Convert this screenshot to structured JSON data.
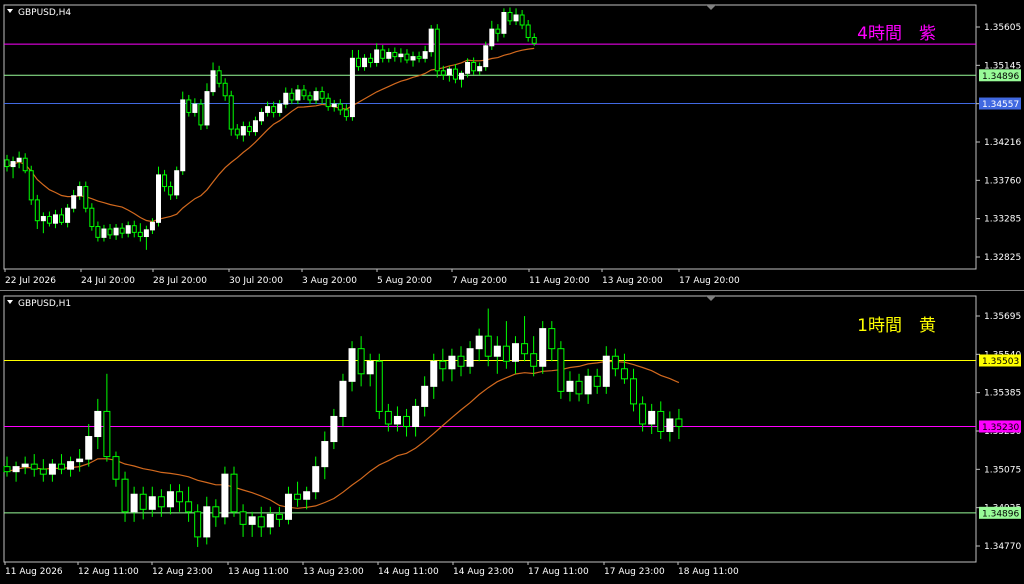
{
  "colors": {
    "background": "#000000",
    "frame": "#c0c0c0",
    "axis_text": "#ffffff",
    "bull": "#ffffff",
    "bear": "#00ff00",
    "ma": "#d2691e",
    "purple": "#ff00ff",
    "yellow": "#ffff00",
    "mint": "#98fb98",
    "blue": "#4169e1"
  },
  "chart_data": [
    {
      "type": "candlestick",
      "symbol_label": "GBPUSD,H4",
      "title": "4時間　紫",
      "title_color": "#ff00ff",
      "ylim": [
        1.3257,
        1.3574
      ],
      "yticks": [
        "1.35605",
        "1.35145",
        "1.34606",
        "1.34216",
        "1.33760",
        "1.33285",
        "1.32825"
      ],
      "xticks": [
        "22 Jul 2026",
        "24 Jul 20:00",
        "28 Jul 20:00",
        "30 Jul 20:00",
        "3 Aug 20:00",
        "5 Aug 20:00",
        "7 Aug 20:00",
        "11 Aug 20:00",
        "13 Aug 20:00",
        "17 Aug 20:00"
      ],
      "levels": [
        {
          "price": 1.3527,
          "color": "#ff00ff",
          "label": ""
        },
        {
          "price": 1.34896,
          "color": "#98fb98",
          "label": "1.34896"
        },
        {
          "price": 1.34557,
          "color": "#4169e1",
          "label": "1.34557"
        }
      ],
      "ohlc": [
        [
          1.3388,
          1.3394,
          1.3374,
          1.338
        ],
        [
          1.338,
          1.3392,
          1.3366,
          1.3386
        ],
        [
          1.3386,
          1.3398,
          1.3378,
          1.339
        ],
        [
          1.339,
          1.3396,
          1.3372,
          1.3375
        ],
        [
          1.3375,
          1.3381,
          1.3334,
          1.334
        ],
        [
          1.334,
          1.3346,
          1.3305,
          1.3315
        ],
        [
          1.3315,
          1.3325,
          1.33,
          1.332
        ],
        [
          1.332,
          1.3326,
          1.3308,
          1.3312
        ],
        [
          1.3312,
          1.3328,
          1.3306,
          1.3322
        ],
        [
          1.3322,
          1.333,
          1.331,
          1.3313
        ],
        [
          1.3313,
          1.3335,
          1.3307,
          1.333
        ],
        [
          1.333,
          1.3352,
          1.3325,
          1.3345
        ],
        [
          1.3345,
          1.3362,
          1.334,
          1.3356
        ],
        [
          1.3356,
          1.3362,
          1.3325,
          1.333
        ],
        [
          1.333,
          1.3336,
          1.3303,
          1.3308
        ],
        [
          1.3308,
          1.3314,
          1.329,
          1.3295
        ],
        [
          1.3295,
          1.331,
          1.329,
          1.3305
        ],
        [
          1.3305,
          1.3311,
          1.3293,
          1.3298
        ],
        [
          1.3298,
          1.3311,
          1.3292,
          1.3306
        ],
        [
          1.3306,
          1.3312,
          1.3294,
          1.33
        ],
        [
          1.33,
          1.3314,
          1.3295,
          1.3309
        ],
        [
          1.3309,
          1.3315,
          1.3295,
          1.3301
        ],
        [
          1.3301,
          1.3312,
          1.329,
          1.3296
        ],
        [
          1.3296,
          1.3309,
          1.328,
          1.3304
        ],
        [
          1.3304,
          1.3318,
          1.3299,
          1.3313
        ],
        [
          1.3313,
          1.338,
          1.3308,
          1.337
        ],
        [
          1.337,
          1.3376,
          1.335,
          1.3356
        ],
        [
          1.3356,
          1.3362,
          1.334,
          1.3346
        ],
        [
          1.3346,
          1.338,
          1.3341,
          1.3375
        ],
        [
          1.3375,
          1.347,
          1.337,
          1.346
        ],
        [
          1.346,
          1.3466,
          1.344,
          1.3445
        ],
        [
          1.3445,
          1.3462,
          1.344,
          1.3455
        ],
        [
          1.3455,
          1.3461,
          1.3424,
          1.343
        ],
        [
          1.343,
          1.348,
          1.3425,
          1.347
        ],
        [
          1.347,
          1.3505,
          1.3465,
          1.3495
        ],
        [
          1.3495,
          1.3501,
          1.3475,
          1.348
        ],
        [
          1.348,
          1.3486,
          1.3459,
          1.3465
        ],
        [
          1.3465,
          1.3471,
          1.3417,
          1.3425
        ],
        [
          1.3425,
          1.3431,
          1.3413,
          1.3418
        ],
        [
          1.3418,
          1.3434,
          1.341,
          1.3428
        ],
        [
          1.3428,
          1.3434,
          1.3417,
          1.3422
        ],
        [
          1.3422,
          1.344,
          1.3417,
          1.3435
        ],
        [
          1.3435,
          1.345,
          1.343,
          1.3445
        ],
        [
          1.3445,
          1.3458,
          1.344,
          1.3452
        ],
        [
          1.3452,
          1.3458,
          1.3439,
          1.3445
        ],
        [
          1.3445,
          1.346,
          1.344,
          1.3455
        ],
        [
          1.3455,
          1.3475,
          1.345,
          1.3468
        ],
        [
          1.3468,
          1.3474,
          1.3455,
          1.346
        ],
        [
          1.346,
          1.3478,
          1.3455,
          1.3472
        ],
        [
          1.3472,
          1.3478,
          1.346,
          1.3465
        ],
        [
          1.3465,
          1.347,
          1.3455,
          1.346
        ],
        [
          1.346,
          1.3475,
          1.3455,
          1.347
        ],
        [
          1.347,
          1.3476,
          1.3455,
          1.3462
        ],
        [
          1.3462,
          1.3468,
          1.3447,
          1.3452
        ],
        [
          1.3452,
          1.346,
          1.3446,
          1.3455
        ],
        [
          1.3455,
          1.3461,
          1.3442,
          1.3448
        ],
        [
          1.3448,
          1.3455,
          1.3435,
          1.344
        ],
        [
          1.344,
          1.352,
          1.3435,
          1.351
        ],
        [
          1.351,
          1.352,
          1.3495,
          1.35
        ],
        [
          1.35,
          1.3515,
          1.3495,
          1.351
        ],
        [
          1.351,
          1.3516,
          1.3499,
          1.3505
        ],
        [
          1.3505,
          1.3528,
          1.35,
          1.352
        ],
        [
          1.352,
          1.3526,
          1.3505,
          1.351
        ],
        [
          1.351,
          1.3522,
          1.3505,
          1.3517
        ],
        [
          1.3517,
          1.3523,
          1.3506,
          1.3512
        ],
        [
          1.3512,
          1.3522,
          1.3505,
          1.3515
        ],
        [
          1.3515,
          1.3521,
          1.3504,
          1.3508
        ],
        [
          1.3508,
          1.3518,
          1.35,
          1.3512
        ],
        [
          1.3512,
          1.3518,
          1.3505,
          1.351
        ],
        [
          1.351,
          1.3525,
          1.3505,
          1.3518
        ],
        [
          1.3518,
          1.355,
          1.3512,
          1.3545
        ],
        [
          1.3545,
          1.3551,
          1.3487,
          1.3495
        ],
        [
          1.3495,
          1.3501,
          1.3484,
          1.349
        ],
        [
          1.349,
          1.35,
          1.3482,
          1.3497
        ],
        [
          1.3497,
          1.3503,
          1.348,
          1.3485
        ],
        [
          1.3485,
          1.3495,
          1.3475,
          1.3492
        ],
        [
          1.3492,
          1.351,
          1.3487,
          1.3505
        ],
        [
          1.3505,
          1.3511,
          1.349,
          1.3495
        ],
        [
          1.3495,
          1.3505,
          1.349,
          1.35
        ],
        [
          1.35,
          1.353,
          1.3495,
          1.3525
        ],
        [
          1.3525,
          1.3555,
          1.352,
          1.3545
        ],
        [
          1.3545,
          1.3551,
          1.353,
          1.354
        ],
        [
          1.354,
          1.357,
          1.3535,
          1.3565
        ],
        [
          1.3565,
          1.3571,
          1.355,
          1.3555
        ],
        [
          1.3555,
          1.357,
          1.355,
          1.3562
        ],
        [
          1.3562,
          1.3568,
          1.3545,
          1.355
        ],
        [
          1.355,
          1.3556,
          1.353,
          1.3535
        ],
        [
          1.3535,
          1.354,
          1.3525,
          1.3528
        ]
      ]
    },
    {
      "type": "candlestick",
      "symbol_label": "GBPUSD,H1",
      "title": "1時間　黄",
      "title_color": "#ffff00",
      "ylim": [
        1.347,
        1.3576
      ],
      "yticks": [
        "1.35695",
        "1.35540",
        "1.35385",
        "1.35230",
        "1.35075",
        "1.34925",
        "1.34770"
      ],
      "xticks": [
        "11 Aug 2026",
        "12 Aug 11:00",
        "12 Aug 23:00",
        "13 Aug 11:00",
        "13 Aug 23:00",
        "14 Aug 11:00",
        "14 Aug 23:00",
        "17 Aug 11:00",
        "17 Aug 23:00",
        "18 Aug 11:00"
      ],
      "levels": [
        {
          "price": 1.35503,
          "color": "#ffff00",
          "label": "1.35503"
        },
        {
          "price": 1.3524,
          "color": "#ff00ff",
          "label": "1.35230"
        },
        {
          "price": 1.34896,
          "color": "#98fb98",
          "label": "1.34896"
        }
      ],
      "ohlc": [
        [
          1.3508,
          1.3512,
          1.3504,
          1.3506
        ],
        [
          1.3506,
          1.351,
          1.3502,
          1.3508
        ],
        [
          1.3508,
          1.3512,
          1.3505,
          1.3509
        ],
        [
          1.3509,
          1.3513,
          1.3504,
          1.3507
        ],
        [
          1.3507,
          1.3511,
          1.3502,
          1.3505
        ],
        [
          1.3505,
          1.3511,
          1.3502,
          1.3509
        ],
        [
          1.3509,
          1.3513,
          1.3505,
          1.3507
        ],
        [
          1.3507,
          1.3512,
          1.3504,
          1.351
        ],
        [
          1.351,
          1.3515,
          1.3506,
          1.3511
        ],
        [
          1.3511,
          1.3525,
          1.3508,
          1.352
        ],
        [
          1.352,
          1.3535,
          1.3515,
          1.353
        ],
        [
          1.353,
          1.3545,
          1.351,
          1.3512
        ],
        [
          1.3512,
          1.3514,
          1.35,
          1.3503
        ],
        [
          1.3503,
          1.3506,
          1.3486,
          1.349
        ],
        [
          1.349,
          1.35,
          1.3486,
          1.3497
        ],
        [
          1.3497,
          1.35,
          1.3487,
          1.3491
        ],
        [
          1.3491,
          1.35,
          1.3488,
          1.3496
        ],
        [
          1.3496,
          1.3499,
          1.3488,
          1.3492
        ],
        [
          1.3492,
          1.3501,
          1.3489,
          1.3498
        ],
        [
          1.3498,
          1.3501,
          1.349,
          1.3494
        ],
        [
          1.3494,
          1.35,
          1.3486,
          1.349
        ],
        [
          1.349,
          1.3493,
          1.3476,
          1.348
        ],
        [
          1.348,
          1.3496,
          1.3477,
          1.3492
        ],
        [
          1.3492,
          1.3495,
          1.3484,
          1.3488
        ],
        [
          1.3488,
          1.3508,
          1.3485,
          1.3505
        ],
        [
          1.3505,
          1.3508,
          1.3488,
          1.349
        ],
        [
          1.349,
          1.3493,
          1.348,
          1.3485
        ],
        [
          1.3485,
          1.349,
          1.348,
          1.3488
        ],
        [
          1.3488,
          1.3492,
          1.348,
          1.3484
        ],
        [
          1.3484,
          1.3492,
          1.3481,
          1.3489
        ],
        [
          1.3489,
          1.3492,
          1.3484,
          1.3487
        ],
        [
          1.3487,
          1.35,
          1.3485,
          1.3497
        ],
        [
          1.3497,
          1.3502,
          1.3492,
          1.3495
        ],
        [
          1.3495,
          1.35,
          1.3491,
          1.3498
        ],
        [
          1.3498,
          1.3512,
          1.3495,
          1.3508
        ],
        [
          1.3508,
          1.3522,
          1.3503,
          1.3518
        ],
        [
          1.3518,
          1.3531,
          1.3515,
          1.3528
        ],
        [
          1.3528,
          1.3545,
          1.3524,
          1.3542
        ],
        [
          1.3542,
          1.3558,
          1.3538,
          1.3555
        ],
        [
          1.3555,
          1.356,
          1.354,
          1.3545
        ],
        [
          1.3545,
          1.3553,
          1.354,
          1.355
        ],
        [
          1.355,
          1.3553,
          1.3527,
          1.353
        ],
        [
          1.353,
          1.3533,
          1.3522,
          1.3525
        ],
        [
          1.3525,
          1.3532,
          1.3522,
          1.3528
        ],
        [
          1.3528,
          1.3531,
          1.352,
          1.3524
        ],
        [
          1.3524,
          1.3535,
          1.352,
          1.3532
        ],
        [
          1.3532,
          1.3544,
          1.3528,
          1.354
        ],
        [
          1.354,
          1.3553,
          1.3535,
          1.355
        ],
        [
          1.355,
          1.3555,
          1.3542,
          1.3547
        ],
        [
          1.3547,
          1.3555,
          1.3542,
          1.3552
        ],
        [
          1.3552,
          1.3556,
          1.3544,
          1.3548
        ],
        [
          1.3548,
          1.3558,
          1.3545,
          1.3555
        ],
        [
          1.3555,
          1.3563,
          1.355,
          1.356
        ],
        [
          1.356,
          1.3571,
          1.3548,
          1.3552
        ],
        [
          1.3552,
          1.356,
          1.3545,
          1.3556
        ],
        [
          1.3556,
          1.3566,
          1.3547,
          1.355
        ],
        [
          1.355,
          1.356,
          1.3545,
          1.3557
        ],
        [
          1.3557,
          1.3568,
          1.355,
          1.3553
        ],
        [
          1.3553,
          1.356,
          1.3544,
          1.3548
        ],
        [
          1.3548,
          1.3566,
          1.3545,
          1.3563
        ],
        [
          1.3563,
          1.3566,
          1.355,
          1.3555
        ],
        [
          1.3555,
          1.3558,
          1.3535,
          1.3538
        ],
        [
          1.3538,
          1.3546,
          1.3534,
          1.3542
        ],
        [
          1.3542,
          1.3545,
          1.3534,
          1.3537
        ],
        [
          1.3537,
          1.3547,
          1.3533,
          1.3544
        ],
        [
          1.3544,
          1.3547,
          1.3537,
          1.354
        ],
        [
          1.354,
          1.3556,
          1.3537,
          1.3552
        ],
        [
          1.3552,
          1.3555,
          1.3544,
          1.3547
        ],
        [
          1.3547,
          1.3553,
          1.3541,
          1.3543
        ],
        [
          1.3543,
          1.3547,
          1.353,
          1.3533
        ],
        [
          1.3533,
          1.3536,
          1.3522,
          1.3525
        ],
        [
          1.3525,
          1.3533,
          1.3521,
          1.353
        ],
        [
          1.353,
          1.3534,
          1.3519,
          1.3522
        ],
        [
          1.3522,
          1.353,
          1.3518,
          1.3527
        ],
        [
          1.3527,
          1.3531,
          1.3519,
          1.3524
        ]
      ]
    }
  ]
}
